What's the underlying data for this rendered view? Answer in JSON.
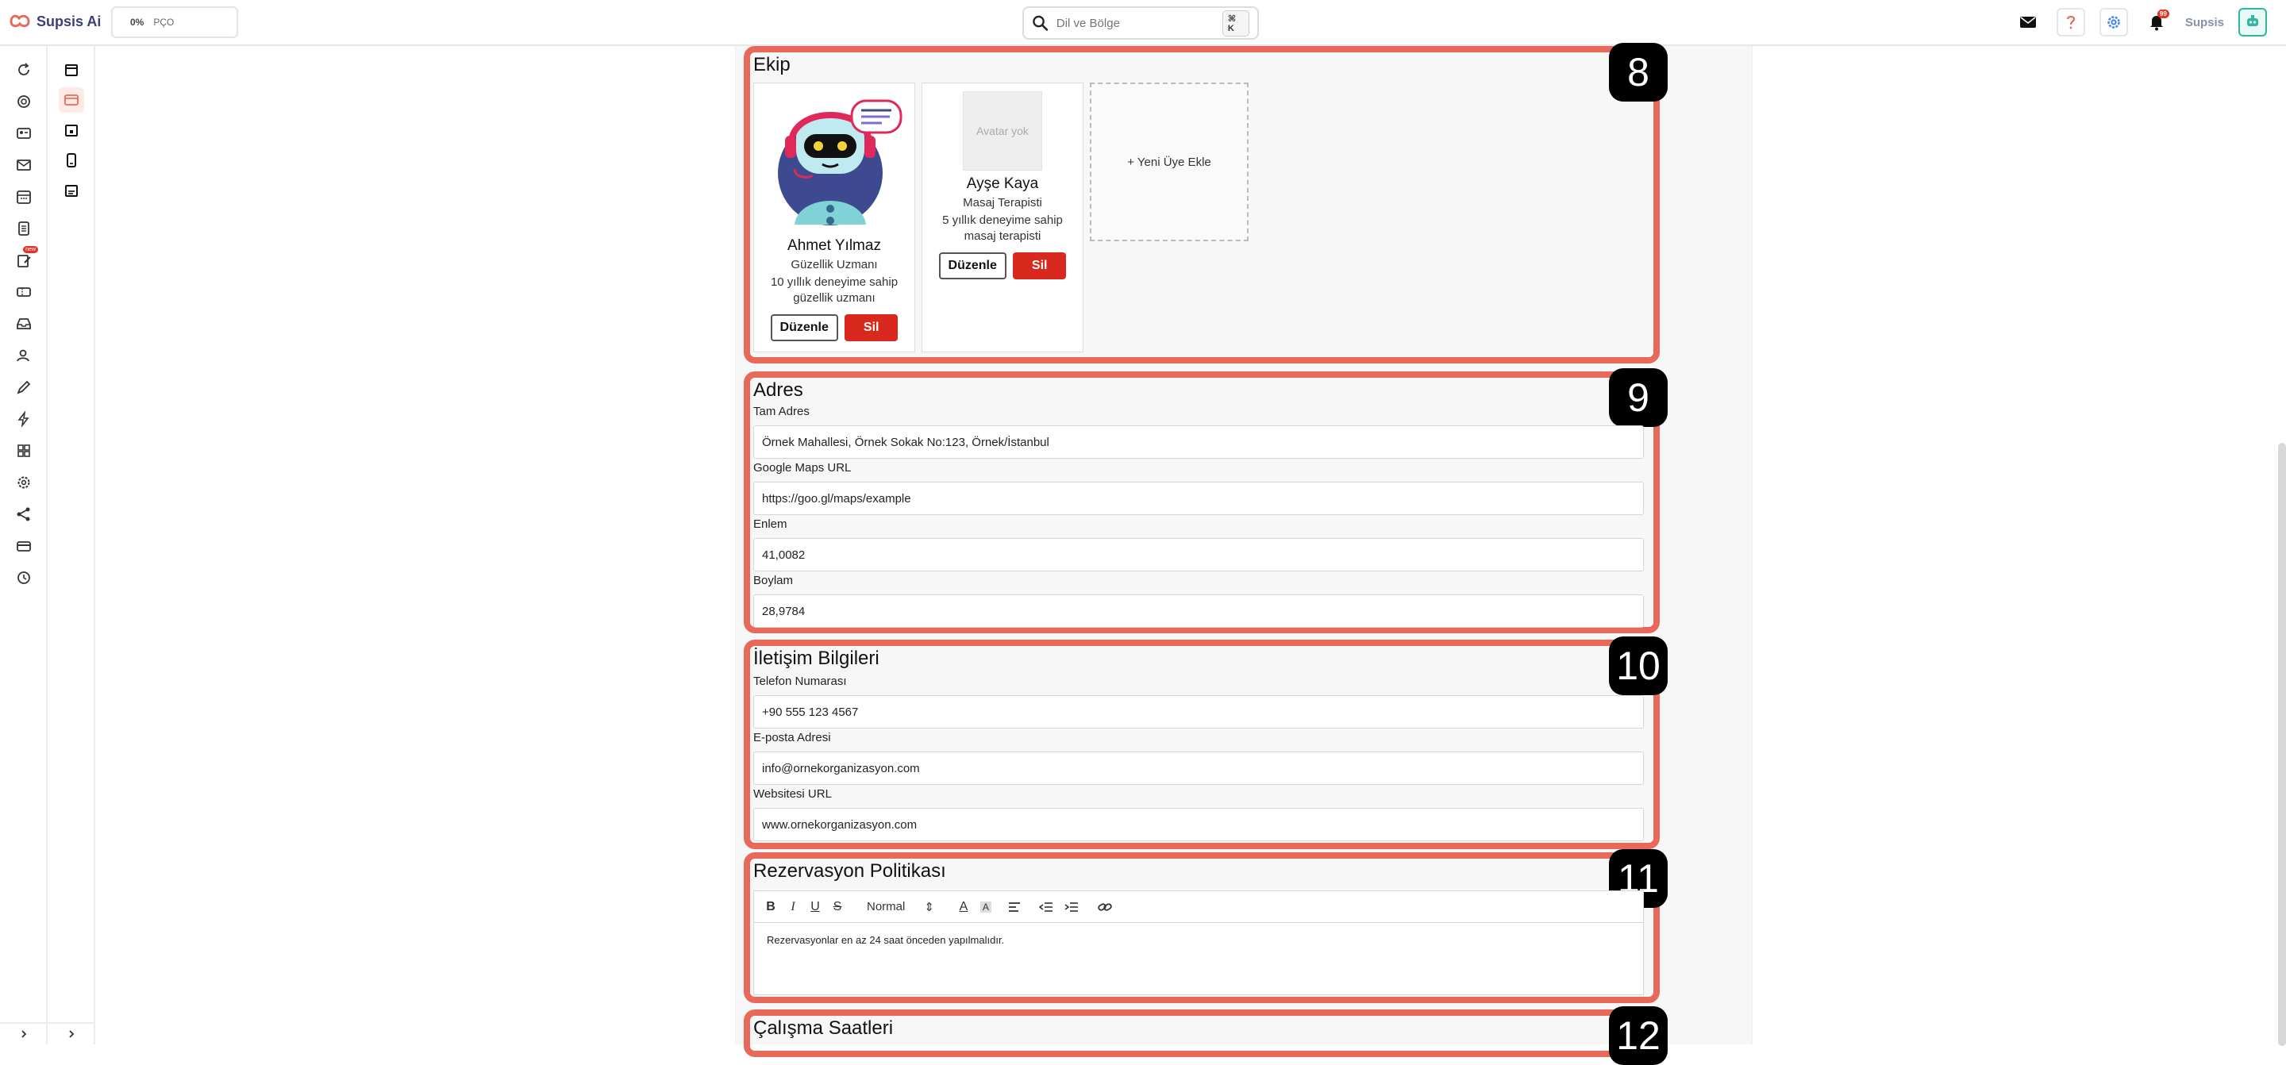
{
  "app": {
    "name": "Supsis Ai"
  },
  "progress": {
    "percent": "0%",
    "label": "PÇO"
  },
  "search": {
    "placeholder": "Dil ve Bölge",
    "shortcut": "⌘ K"
  },
  "user": {
    "name": "Supsis",
    "notification_count": "99"
  },
  "sidebar": {
    "badge": "new"
  },
  "sections": {
    "team": {
      "number": "8",
      "title": "Ekip",
      "members": [
        {
          "name": "Ahmet Yılmaz",
          "role": "Güzellik Uzmanı",
          "desc": "10 yıllık deneyime sahip güzellik uzmanı",
          "edit": "Düzenle",
          "delete": "Sil"
        },
        {
          "name": "Ayşe Kaya",
          "role": "Masaj Terapisti",
          "desc": "5 yıllık deneyime sahip masaj terapisti",
          "avatar_placeholder": "Avatar yok",
          "edit": "Düzenle",
          "delete": "Sil"
        }
      ],
      "add_label": "+ Yeni Üye Ekle"
    },
    "address": {
      "number": "9",
      "title": "Adres",
      "fields": [
        {
          "label": "Tam Adres",
          "value": "Örnek Mahallesi, Örnek Sokak No:123, Örnek/İstanbul"
        },
        {
          "label": "Google Maps URL",
          "value": "https://goo.gl/maps/example"
        },
        {
          "label": "Enlem",
          "value": "41,0082"
        },
        {
          "label": "Boylam",
          "value": "28,9784"
        }
      ]
    },
    "contact": {
      "number": "10",
      "title": "İletişim Bilgileri",
      "fields": [
        {
          "label": "Telefon Numarası",
          "value": "+90 555 123 4567"
        },
        {
          "label": "E-posta Adresi",
          "value": "info@ornekorganizasyon.com"
        },
        {
          "label": "Websitesi URL",
          "value": "www.ornekorganizasyon.com"
        }
      ]
    },
    "policy": {
      "number": "11",
      "title": "Rezervasyon Politikası",
      "toolbar": {
        "bold": "B",
        "italic": "I",
        "underline": "U",
        "strike": "S",
        "format": "Normal",
        "format_arrow": "⇕",
        "font_color": "A",
        "bg_color": "A"
      },
      "content": "Rezervasyonlar en az 24 saat önceden yapılmalıdır."
    },
    "hours": {
      "number": "12",
      "title": "Çalışma Saatleri"
    }
  },
  "colors": {
    "accent": "#e8695a",
    "danger": "#d9281e",
    "brand": "#3a3f7a"
  }
}
